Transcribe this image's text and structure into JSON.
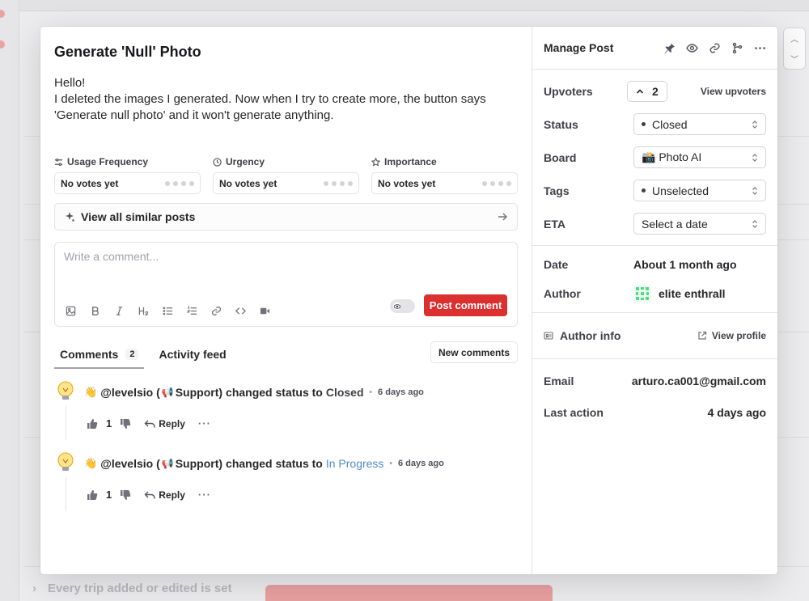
{
  "background": {
    "bottom_row_text": "Every trip added or edited is set"
  },
  "post": {
    "title": "Generate 'Null' Photo",
    "body_line1": "Hello!",
    "body_line2": "I deleted the images I generated. Now when I try to create more, the button says 'Generate null photo' and it won't generate anything."
  },
  "metrics": [
    {
      "label": "Usage Frequency",
      "value": "No votes yet",
      "icon": "sliders-icon"
    },
    {
      "label": "Urgency",
      "value": "No votes yet",
      "icon": "clock-icon"
    },
    {
      "label": "Importance",
      "value": "No votes yet",
      "icon": "star-icon"
    }
  ],
  "similar": {
    "label": "View all similar posts"
  },
  "comment_editor": {
    "placeholder": "Write a comment...",
    "submit_label": "Post comment"
  },
  "tabs": {
    "comments_label": "Comments",
    "comments_count": "2",
    "activity_label": "Activity feed",
    "new_comments_label": "New comments"
  },
  "activity": [
    {
      "user": "@levelsio (",
      "role": "Support)",
      "action": "changed status to",
      "status": "Closed",
      "time": "6 days ago",
      "votes": "1",
      "reply_label": "Reply"
    },
    {
      "user": "@levelsio (",
      "role": "Support)",
      "action": "changed status to",
      "status": "In Progress",
      "time": "6 days ago",
      "votes": "1",
      "reply_label": "Reply"
    }
  ],
  "side": {
    "title": "Manage Post",
    "upvoters_label": "Upvoters",
    "upvoters_count": "2",
    "view_upvoters": "View upvoters",
    "status_label": "Status",
    "status_value": "Closed",
    "board_label": "Board",
    "board_value": "📸 Photo AI",
    "tags_label": "Tags",
    "tags_value": "Unselected",
    "eta_label": "ETA",
    "eta_value": "Select a date",
    "date_label": "Date",
    "date_value": "About 1 month ago",
    "author_label": "Author",
    "author_value": "elite enthrall",
    "author_info_label": "Author info",
    "view_profile": "View profile",
    "email_label": "Email",
    "email_value": "arturo.ca001@gmail.com",
    "last_action_label": "Last action",
    "last_action_value": "4 days ago"
  },
  "colors": {
    "accent": "#dc2f2f",
    "in_progress": "#4f8cc9"
  }
}
